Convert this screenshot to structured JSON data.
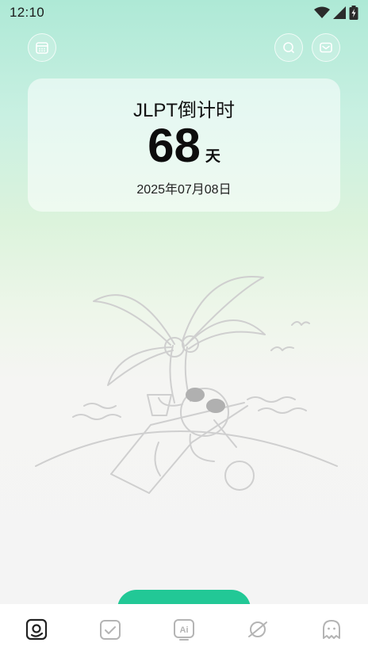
{
  "status_bar": {
    "time": "12:10",
    "icons": [
      "wifi-icon",
      "signal-icon",
      "battery-icon"
    ]
  },
  "header": {
    "left_icon": "calendar-icon",
    "right_icons": [
      "search-icon",
      "mail-icon"
    ]
  },
  "countdown": {
    "title": "JLPT倒计时",
    "number": "68",
    "unit": "天",
    "date": "2025年07月08日"
  },
  "fab": {
    "label": ""
  },
  "bottom_nav": {
    "items": [
      {
        "icon": "home-card-icon",
        "active": true
      },
      {
        "icon": "checklist-icon",
        "active": false
      },
      {
        "icon": "ai-icon",
        "active": false,
        "label": "Ai"
      },
      {
        "icon": "planet-icon",
        "active": false
      },
      {
        "icon": "ghost-icon",
        "active": false
      }
    ]
  },
  "colors": {
    "accent": "#22c896",
    "nav_active": "#222222",
    "nav_inactive": "#b4b4b4"
  }
}
